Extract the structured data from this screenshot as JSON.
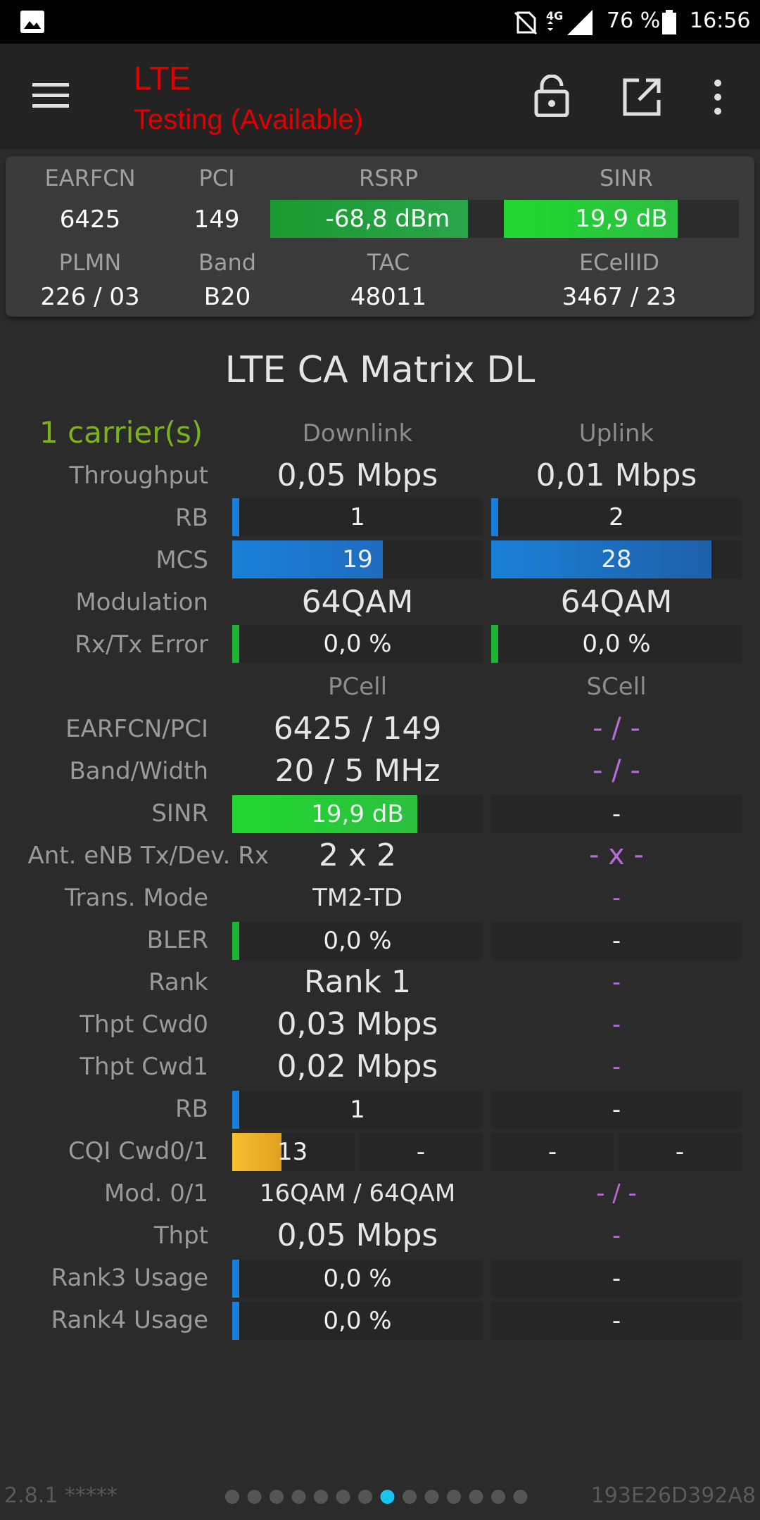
{
  "status_bar": {
    "battery_percent": "76 %",
    "time": "16:56",
    "network": "4G"
  },
  "app_bar": {
    "title": "LTE",
    "subtitle": "Testing (Available)"
  },
  "info_panel": {
    "headers_row1": [
      "EARFCN",
      "PCI",
      "RSRP",
      "SINR"
    ],
    "earfcn": "6425",
    "pci": "149",
    "rsrp": "-68,8 dBm",
    "rsrp_level": 0.84,
    "sinr": "19,9 dB",
    "sinr_level": 0.74,
    "headers_row2": [
      "PLMN",
      "Band",
      "TAC",
      "ECellID"
    ],
    "plmn": "226 / 03",
    "band": "B20",
    "tac": "48011",
    "ecellid": "3467 / 23"
  },
  "main": {
    "title": "LTE CA Matrix DL",
    "carriers": "1 carrier(s)",
    "col_downlink": "Downlink",
    "col_uplink": "Uplink",
    "col_pcell": "PCell",
    "col_scell": "SCell",
    "labels": {
      "throughput": "Throughput",
      "rb": "RB",
      "mcs": "MCS",
      "modulation": "Modulation",
      "rxtx_error": "Rx/Tx Error",
      "earfcn_pci": "EARFCN/PCI",
      "band_width": "Band/Width",
      "sinr": "SINR",
      "ant": "Ant. eNB Tx/Dev. Rx",
      "trans_mode": "Trans. Mode",
      "bler": "BLER",
      "rank": "Rank",
      "thpt_cwd0": "Thpt Cwd0",
      "thpt_cwd1": "Thpt Cwd1",
      "rb2": "RB",
      "cqi": "CQI Cwd0/1",
      "mod01": "Mod. 0/1",
      "thpt": "Thpt",
      "rank3": "Rank3 Usage",
      "rank4": "Rank4 Usage"
    },
    "downlink": {
      "throughput": "0,05 Mbps",
      "rb": "1",
      "rb_level": 0.02,
      "mcs": "19",
      "mcs_level": 0.6,
      "modulation": "64QAM",
      "error": "0,0 %"
    },
    "uplink": {
      "throughput": "0,01 Mbps",
      "rb": "2",
      "rb_level": 0.02,
      "mcs": "28",
      "mcs_level": 0.88,
      "modulation": "64QAM",
      "error": "0,0 %"
    },
    "pcell": {
      "earfcn_pci": "6425 / 149",
      "band_width": "20 / 5 MHz",
      "sinr": "19,9 dB",
      "sinr_level": 0.74,
      "ant": "2 x 2",
      "trans_mode": "TM2-TD",
      "bler": "0,0 %",
      "rank": "Rank 1",
      "thpt_cwd0": "0,03 Mbps",
      "thpt_cwd1": "0,02 Mbps",
      "rb": "1",
      "cqi0": "13",
      "cqi0_level": 0.4,
      "cqi1": "-",
      "mod01": "16QAM / 64QAM",
      "thpt": "0,05 Mbps",
      "rank3": "0,0 %",
      "rank4": "0,0 %"
    },
    "scell": {
      "earfcn_pci": "- / -",
      "band_width": "- / -",
      "sinr": "-",
      "ant": "- x -",
      "trans_mode": "-",
      "bler": "-",
      "rank": "-",
      "thpt_cwd0": "-",
      "thpt_cwd1": "-",
      "rb": "-",
      "cqi0": "-",
      "cqi1": "-",
      "mod01": "- / -",
      "thpt": "-",
      "rank3": "-",
      "rank4": "-"
    }
  },
  "footer": {
    "version": "2.8.1 *****",
    "device_id": "193E26D392A8",
    "page_count": 14,
    "active_page": 7
  },
  "colors": {
    "green_bar": "#1db335",
    "blue_bar": "#1a7fd8",
    "orange_bar": "#f0b030",
    "red_title": "#e00000",
    "purple": "#b76bd9",
    "active_dot": "#18c4f0"
  }
}
